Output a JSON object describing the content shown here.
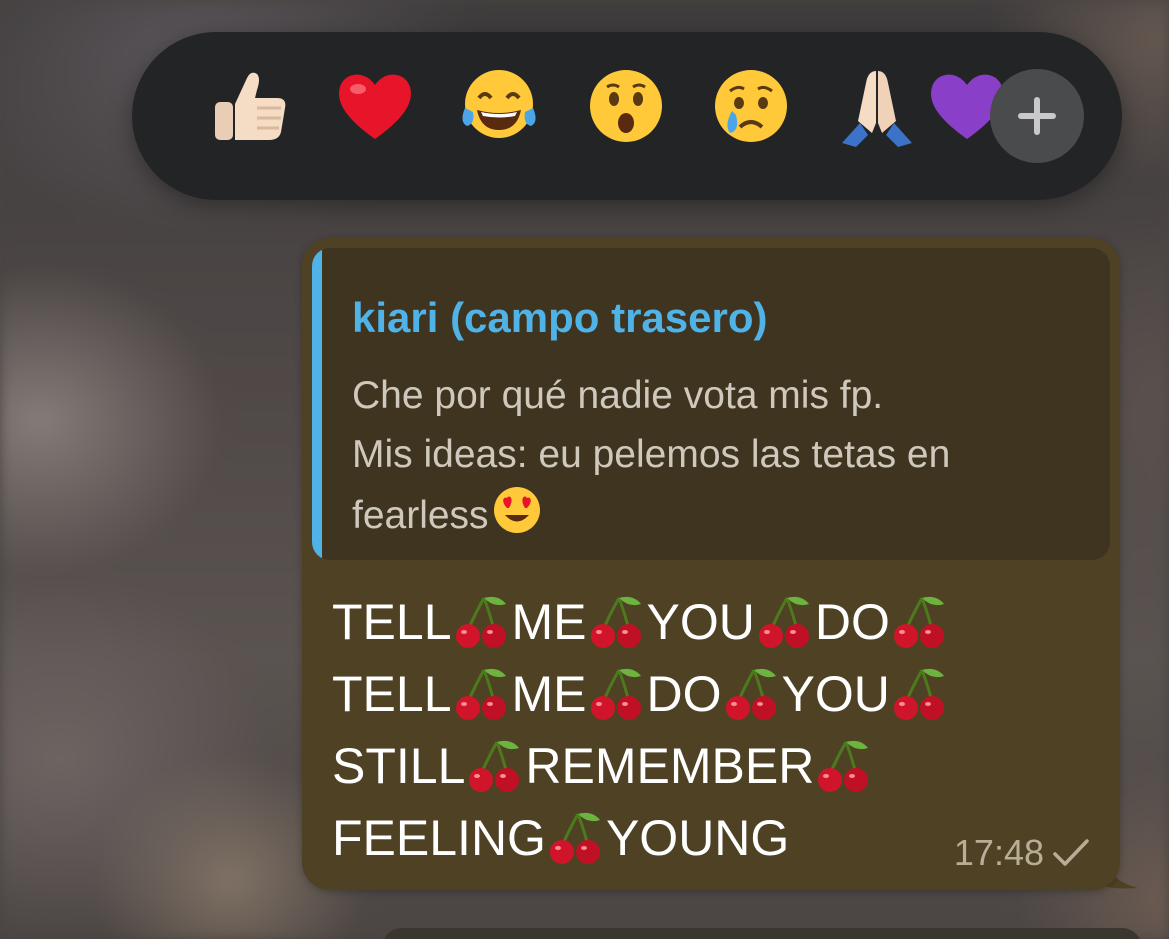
{
  "reactions": [
    {
      "emoji": "👍🏻",
      "icon": "thumbs-up-icon"
    },
    {
      "emoji": "❤️",
      "icon": "red-heart-icon"
    },
    {
      "emoji": "😂",
      "icon": "tears-of-joy-icon"
    },
    {
      "emoji": "😮",
      "icon": "surprised-face-icon"
    },
    {
      "emoji": "😢",
      "icon": "crying-face-icon"
    },
    {
      "emoji": "🙏🏻",
      "icon": "folded-hands-icon"
    },
    {
      "emoji": "💜",
      "icon": "purple-heart-icon"
    }
  ],
  "more_reactions_label": "+",
  "message": {
    "quote": {
      "author": "kiari (campo trasero)",
      "lines": [
        "Che por qué nadie vota mis fp.",
        "Mis ideas: eu pelemos las tetas en",
        "fearless"
      ],
      "trailing_emoji": "😍"
    },
    "lines": [
      {
        "words": [
          "TELL",
          "ME",
          "YOU",
          "DO"
        ],
        "trailing_cherry": true
      },
      {
        "words": [
          "TELL",
          "ME",
          "DO",
          "YOU"
        ],
        "trailing_cherry": true
      },
      {
        "words": [
          "STILL",
          "REMEMBER"
        ],
        "trailing_cherry": true
      },
      {
        "words": [
          "FEELING",
          "YOUNG"
        ],
        "trailing_cherry": false
      }
    ],
    "separator_emoji": "🍒",
    "time": "17:48",
    "status": "sent"
  },
  "colors": {
    "bar_bg": "#232425",
    "bubble_bg": "#4f4224",
    "quote_bg": "#3f3420",
    "accent": "#4fb3e8"
  }
}
